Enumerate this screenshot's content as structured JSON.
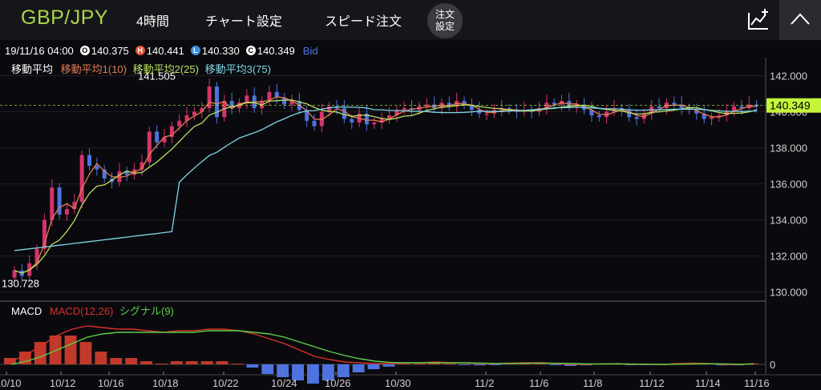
{
  "header": {
    "pair": "GBP/JPY",
    "timeframe": "4時間",
    "chart_settings": "チャート設定",
    "speed_order": "スピード注文",
    "order_settings_line1": "注文",
    "order_settings_line2": "設定",
    "draw_icon": "chart-draw-icon",
    "collapse_icon": "chevron-up-icon"
  },
  "ohlc": {
    "datetime": "19/11/16 04:00",
    "open_badge": "O",
    "open": "140.375",
    "high_badge": "H",
    "high": "140.441",
    "low_badge": "L",
    "low": "140.330",
    "close_badge": "C",
    "close": "140.349",
    "price_type": "Bid"
  },
  "main_legend": {
    "title": "移動平均",
    "ma1": "移動平均1(10)",
    "ma2": "移動平均2(25)",
    "ma3": "移動平均3(75)"
  },
  "macd_legend": {
    "title": "MACD",
    "macd": "MACD(12,26)",
    "signal": "シグナル(9)"
  },
  "colors": {
    "up": "#d6336c",
    "down": "#4e73e0",
    "ma1": "#e57b52",
    "ma2": "#b9e05f",
    "ma3": "#7fd6e4",
    "macd": "#d8302a",
    "signal": "#5cd048",
    "current_price_bg": "#c4f53a"
  },
  "chart_data": [
    {
      "type": "candlestick",
      "title": "",
      "y_ticks": [
        "142.000",
        "140.000",
        "138.000",
        "136.000",
        "134.000",
        "132.000",
        "130.000"
      ],
      "ylim": [
        129.5,
        143.0
      ],
      "x_ticks": [
        "10/10",
        "10/12",
        "10/16",
        "10/18",
        "10/22",
        "10/24",
        "10/26",
        "10/30",
        "11/2",
        "11/6",
        "11/8",
        "11/12",
        "11/14",
        "11/16"
      ],
      "annotations": [
        {
          "label": "141.505",
          "value": 141.505,
          "kind": "high"
        },
        {
          "label": "130.728",
          "value": 130.728,
          "kind": "low"
        }
      ],
      "current_price": {
        "label": "140.349",
        "value": 140.349
      },
      "candles_close": [
        131.2,
        130.9,
        131.6,
        132.4,
        134.0,
        135.8,
        134.3,
        134.6,
        135.0,
        137.6,
        137.0,
        136.8,
        136.3,
        136.1,
        136.7,
        136.5,
        136.8,
        137.2,
        138.9,
        138.3,
        138.6,
        139.2,
        139.5,
        139.8,
        140.0,
        140.2,
        141.4,
        139.7,
        140.6,
        140.2,
        140.5,
        140.9,
        140.2,
        140.6,
        141.1,
        140.8,
        140.4,
        140.6,
        140.1,
        139.5,
        139.2,
        140.0,
        140.3,
        140.2,
        139.6,
        139.4,
        139.9,
        139.3,
        139.4,
        139.6,
        139.8,
        140.1,
        140.2,
        140.1,
        140.3,
        140.4,
        140.2,
        140.5,
        140.3,
        140.6,
        140.4,
        140.1,
        139.9,
        139.9,
        140.1,
        140.2,
        140.1,
        140.0,
        140.1,
        140.0,
        140.2,
        140.5,
        140.4,
        140.6,
        140.3,
        140.4,
        140.1,
        139.8,
        139.7,
        140.0,
        140.2,
        140.1,
        139.7,
        139.6,
        139.9,
        140.3,
        140.2,
        140.5,
        140.4,
        140.2,
        140.1,
        139.9,
        139.6,
        139.7,
        139.8,
        140.0,
        140.3,
        140.2,
        140.4,
        140.3
      ],
      "ma_series": [
        "移動平均1(10)",
        "移動平均2(25)",
        "移動平均3(75)"
      ]
    },
    {
      "type": "line+bar",
      "title": "MACD",
      "y_ticks": [
        "0"
      ],
      "series": [
        {
          "name": "MACD(12,26)",
          "values": [
            0.2,
            0.6,
            1.2,
            1.8,
            2.2,
            2.4,
            2.3,
            2.2,
            2.2,
            2.1,
            2.0,
            2.1,
            2.1,
            2.2,
            2.2,
            2.1,
            1.9,
            1.6,
            1.3,
            0.9,
            0.5,
            0.3,
            0.15,
            0.1,
            0.05,
            0.05,
            0.1,
            0.1,
            0.15,
            0.1,
            0.08,
            0.05,
            0.05,
            0.08,
            0.1,
            0.1,
            0.05,
            0.0,
            0.0,
            0.03,
            0.05,
            0.0,
            0.0,
            -0.02,
            0.05,
            0.08,
            0.05,
            0.0,
            -0.02,
            0.05
          ]
        },
        {
          "name": "シグナル(9)",
          "values": [
            0.0,
            0.2,
            0.5,
            0.9,
            1.3,
            1.7,
            1.9,
            2.0,
            2.0,
            2.0,
            2.0,
            2.0,
            2.0,
            2.1,
            2.1,
            2.1,
            2.0,
            1.9,
            1.7,
            1.4,
            1.1,
            0.8,
            0.55,
            0.35,
            0.2,
            0.12,
            0.1,
            0.1,
            0.1,
            0.1,
            0.1,
            0.08,
            0.06,
            0.06,
            0.07,
            0.08,
            0.07,
            0.05,
            0.03,
            0.03,
            0.03,
            0.02,
            0.01,
            0.0,
            0.01,
            0.03,
            0.04,
            0.03,
            0.01,
            0.02
          ]
        }
      ]
    }
  ]
}
